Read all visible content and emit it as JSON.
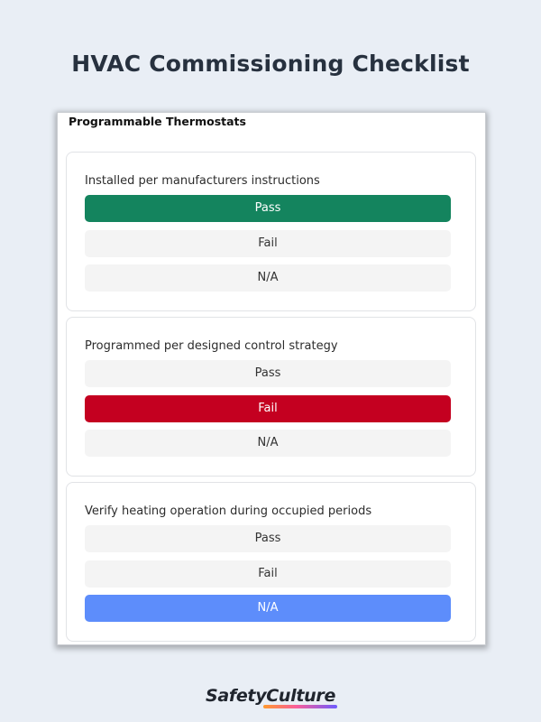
{
  "page": {
    "title": "HVAC Commissioning Checklist"
  },
  "section": {
    "title": "Programmable Thermostats"
  },
  "items": [
    {
      "question": "Installed per manufacturers instructions",
      "options": [
        "Pass",
        "Fail",
        "N/A"
      ],
      "selected": "Pass"
    },
    {
      "question": "Programmed per designed control strategy",
      "options": [
        "Pass",
        "Fail",
        "N/A"
      ],
      "selected": "Fail"
    },
    {
      "question": "Verify heating operation during occupied periods",
      "options": [
        "Pass",
        "Fail",
        "N/A"
      ],
      "selected": "N/A"
    }
  ],
  "colors": {
    "pass": "#14845e",
    "fail": "#c40020",
    "na": "#5d8dfb"
  },
  "brand": {
    "logo_text": "SafetyCulture"
  }
}
